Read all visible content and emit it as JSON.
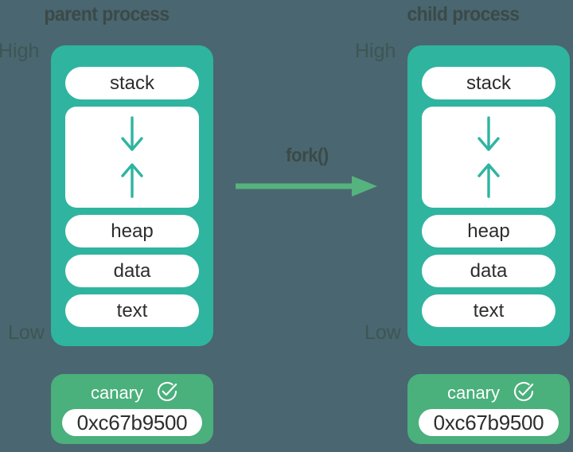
{
  "diagram": {
    "background_color": "#4a6670",
    "accent_teal": "#2fb4a0",
    "accent_green": "#4ab07c",
    "title_color": "#3b4a47"
  },
  "fork": {
    "label": "fork()",
    "arrow_icon": "right-arrow-icon",
    "arrow_color": "#55b37e"
  },
  "processes": [
    {
      "title": "parent process",
      "high_label": "High",
      "low_label": "Low",
      "segments": [
        {
          "label": "stack",
          "type": "pill"
        },
        {
          "label": "",
          "type": "gap",
          "down_icon": "arrow-down-icon",
          "up_icon": "arrow-up-icon"
        },
        {
          "label": "heap",
          "type": "pill"
        },
        {
          "label": "data",
          "type": "pill"
        },
        {
          "label": "text",
          "type": "pill"
        }
      ],
      "canary": {
        "label": "canary",
        "value": "0xc67b9500",
        "status_icon": "check-circle-icon"
      }
    },
    {
      "title": "child process",
      "high_label": "High",
      "low_label": "Low",
      "segments": [
        {
          "label": "stack",
          "type": "pill"
        },
        {
          "label": "",
          "type": "gap",
          "down_icon": "arrow-down-icon",
          "up_icon": "arrow-up-icon"
        },
        {
          "label": "heap",
          "type": "pill"
        },
        {
          "label": "data",
          "type": "pill"
        },
        {
          "label": "text",
          "type": "pill"
        }
      ],
      "canary": {
        "label": "canary",
        "value": "0xc67b9500",
        "status_icon": "check-circle-icon"
      }
    }
  ]
}
